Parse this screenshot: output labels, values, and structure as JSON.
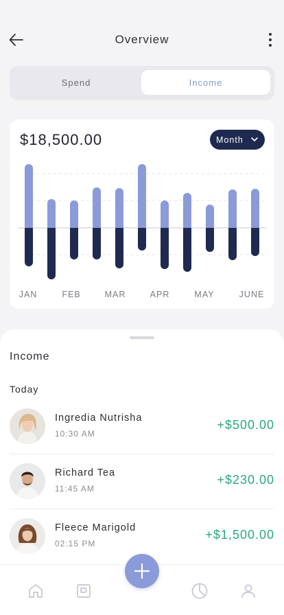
{
  "header": {
    "title": "Overview"
  },
  "segment": {
    "spend_label": "Spend",
    "income_label": "Income"
  },
  "summary": {
    "amount": "$18,500.00",
    "period_label": "Month"
  },
  "chart_data": {
    "type": "bar",
    "categories": [
      "JAN",
      "FEB",
      "MAR",
      "APR",
      "MAY",
      "JUNE"
    ],
    "bars_per_category": 2,
    "series": [
      {
        "values": [
          93,
          42,
          40,
          59,
          58,
          93,
          40,
          51,
          34,
          56,
          57
        ]
      },
      {
        "values": [
          -56,
          -75,
          -46,
          -46,
          -59,
          -33,
          -60,
          -64,
          -35,
          -47,
          -41
        ]
      }
    ],
    "colors": {
      "positive": "#8b9ad8",
      "negative": "#1f2a50"
    },
    "grid": true
  },
  "sheet": {
    "title": "Income",
    "section": "Today",
    "transactions": [
      {
        "name": "Ingredia Nutrisha",
        "time": "10:30 AM",
        "amount": "+$500.00"
      },
      {
        "name": "Richard Tea",
        "time": "11:45 AM",
        "amount": "+$230.00"
      },
      {
        "name": "Fleece Marigold",
        "time": "02:15 PM",
        "amount": "+$1,500.00"
      }
    ]
  },
  "icons": {
    "back": "arrow-left-icon",
    "more": "more-vertical-icon",
    "chevron": "chevron-down-icon",
    "home": "home-icon",
    "wallet": "wallet-icon",
    "add": "plus-icon",
    "stats": "pie-chart-icon",
    "profile": "user-icon"
  },
  "colors": {
    "accent": "#8b9ad8",
    "navy": "#1f2a50",
    "income_green": "#2ba87a"
  }
}
